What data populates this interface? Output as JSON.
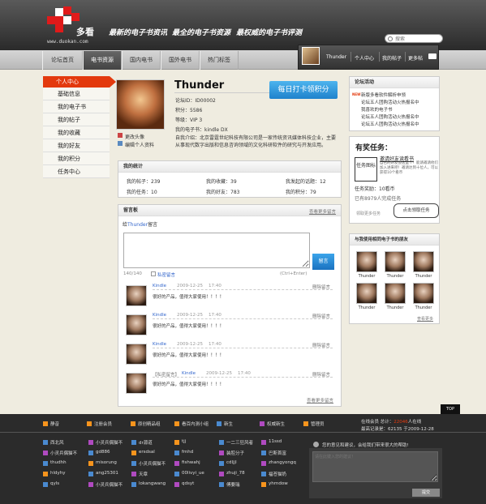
{
  "header": {
    "logo_text": "多看",
    "logo_url": "www.duokan.com",
    "slogans": [
      "最新的电子书资讯",
      "最全的电子书资源",
      "最权威的电子书评测"
    ],
    "search_placeholder": "搜索"
  },
  "nav": {
    "tabs": [
      {
        "label": "论坛首页",
        "active": false
      },
      {
        "label": "电书资源",
        "active": true
      },
      {
        "label": "国内电书",
        "active": false
      },
      {
        "label": "国外电书",
        "active": false
      },
      {
        "label": "热门标签",
        "active": false
      }
    ]
  },
  "userbar": {
    "username": "Thunder",
    "links": [
      "个人中心",
      "我的帖子",
      "更多帖"
    ]
  },
  "leftmenu": {
    "header": "个人中心",
    "items": [
      "基础信息",
      "我的电子书",
      "我的帖子",
      "我的收藏",
      "我的好友",
      "我的积分",
      "任务中心"
    ]
  },
  "profile": {
    "name": "Thunder",
    "checkin_label": "每日打卡领积分",
    "info": [
      "论坛ID：ID00002",
      "积分：5586",
      "等级：VIP 3",
      "我的电子书：kindle DX"
    ],
    "intro": "自我介绍：北京雷霆世纪科技有限公司是一家传统资讯媒体科技企业，主要从事现代数字出版和信息咨询领域的文化科研软件的研究与开发应用。",
    "change_avatar": "更改头像",
    "edit_profile": "编辑个人资料"
  },
  "stats": {
    "title": "我的统计",
    "cells": [
      [
        "我的帖子：239",
        "我的收藏：39",
        "我发起的话题：12"
      ],
      [
        "我的任务：10",
        "我的好友：783",
        "我的积分：79"
      ]
    ]
  },
  "guestbook": {
    "title": "留言板",
    "more": "查看更多留言",
    "to_label": "给",
    "to_user": "Thunder",
    "to_suffix": "留言",
    "char_count": "140/140",
    "private_label": "私密留言",
    "shortcut": "(Ctrl+Enter)",
    "submit": "留言",
    "messages": [
      {
        "user": "Kindle",
        "date": "2009-12-25",
        "time": "17:40",
        "text": "很好的产品，值得大家使用！！！！",
        "action": "删除留言",
        "private": ""
      },
      {
        "user": "Kindle",
        "date": "2009-12-25",
        "time": "17:40",
        "text": "很好的产品，值得大家使用！！！！",
        "action": "删除留言",
        "private": ""
      },
      {
        "user": "Kindle",
        "date": "2009-12-25",
        "time": "17:40",
        "text": "很好的产品，值得大家使用！！！！",
        "action": "删除留言",
        "private": ""
      },
      {
        "user": "Kindle",
        "date": "2009-12-25",
        "time": "17:40",
        "text": "很好的产品，值得大家使用！！！！",
        "action": "删除留言",
        "private": "【私密留言】"
      }
    ],
    "more_bottom": "查看更多留言"
  },
  "forum_activity": {
    "title": "论坛活动",
    "items": [
      "新版多看软件解析申领",
      "论坛五人团购活动火热报名中",
      "我喜欢的电子书",
      "论坛五人团购活动火热报名中",
      "论坛五人团购活动火热报名中"
    ]
  },
  "tasks": {
    "title": "有奖任务：",
    "box_title": "任务图标",
    "task_name": "邀请好友读看书",
    "task_desc": "自已的好友会这里个！能请邀请他们加入进来吧！邀请达到十位人，可以获得10个看币",
    "reward": "任务奖励：10看币",
    "completed": "已有8979人完成任务",
    "more_tasks": "领取更多任务",
    "claim": "点击领取任务"
  },
  "friends": {
    "title": "与我使用相同电子书的朋友",
    "names": [
      "Thunder",
      "Thunder",
      "Thunder",
      "Thunder",
      "Thunder",
      "Thunder"
    ],
    "more": "查看更多"
  },
  "footer": {
    "top_btn": "TOP",
    "row1": [
      "静音",
      "注册会员",
      "原创精品组",
      "看百内测小组",
      "新生",
      "权威新生",
      "管理员"
    ],
    "online_label": "在线会员",
    "online_total_label": "总计：",
    "online_total": "22046",
    "online_suffix": "人在线",
    "record_label": "最高记录是：",
    "record_value": "62135",
    "record_date": "于2009-12-28",
    "members": [
      [
        "西北风",
        "小灵兵偶猫不",
        "dr源道",
        "tjj",
        "一二三狂风者",
        "11ssd"
      ],
      [
        "小灵兵偶猫不",
        "gd886",
        "ersdsal",
        "fmhd",
        "装腔分子",
        "巴斯首富"
      ],
      [
        "thudhh",
        "misorung",
        "小灵兵偶猫不",
        "fishwahj",
        "cdljjl",
        "zhangyongq"
      ],
      [
        "hldyhy",
        "ang25301",
        "天章",
        "00livyi_ue",
        "zhuji_78",
        "福苍猫奶"
      ],
      [
        "qyls",
        "小灵兵偶猫不",
        "lokangwang",
        "qdsyt",
        "傅要瑞",
        "yhrndow"
      ]
    ],
    "feedback_prompt": "您的意见和建议，会给我们带来很大的帮助!",
    "feedback_placeholder": "请在此键入您的建议！",
    "feedback_submit": "提交"
  },
  "colors": {
    "accent_red": "#e3390d",
    "button_blue": "#1e82cc",
    "link_blue": "#3366cc"
  }
}
